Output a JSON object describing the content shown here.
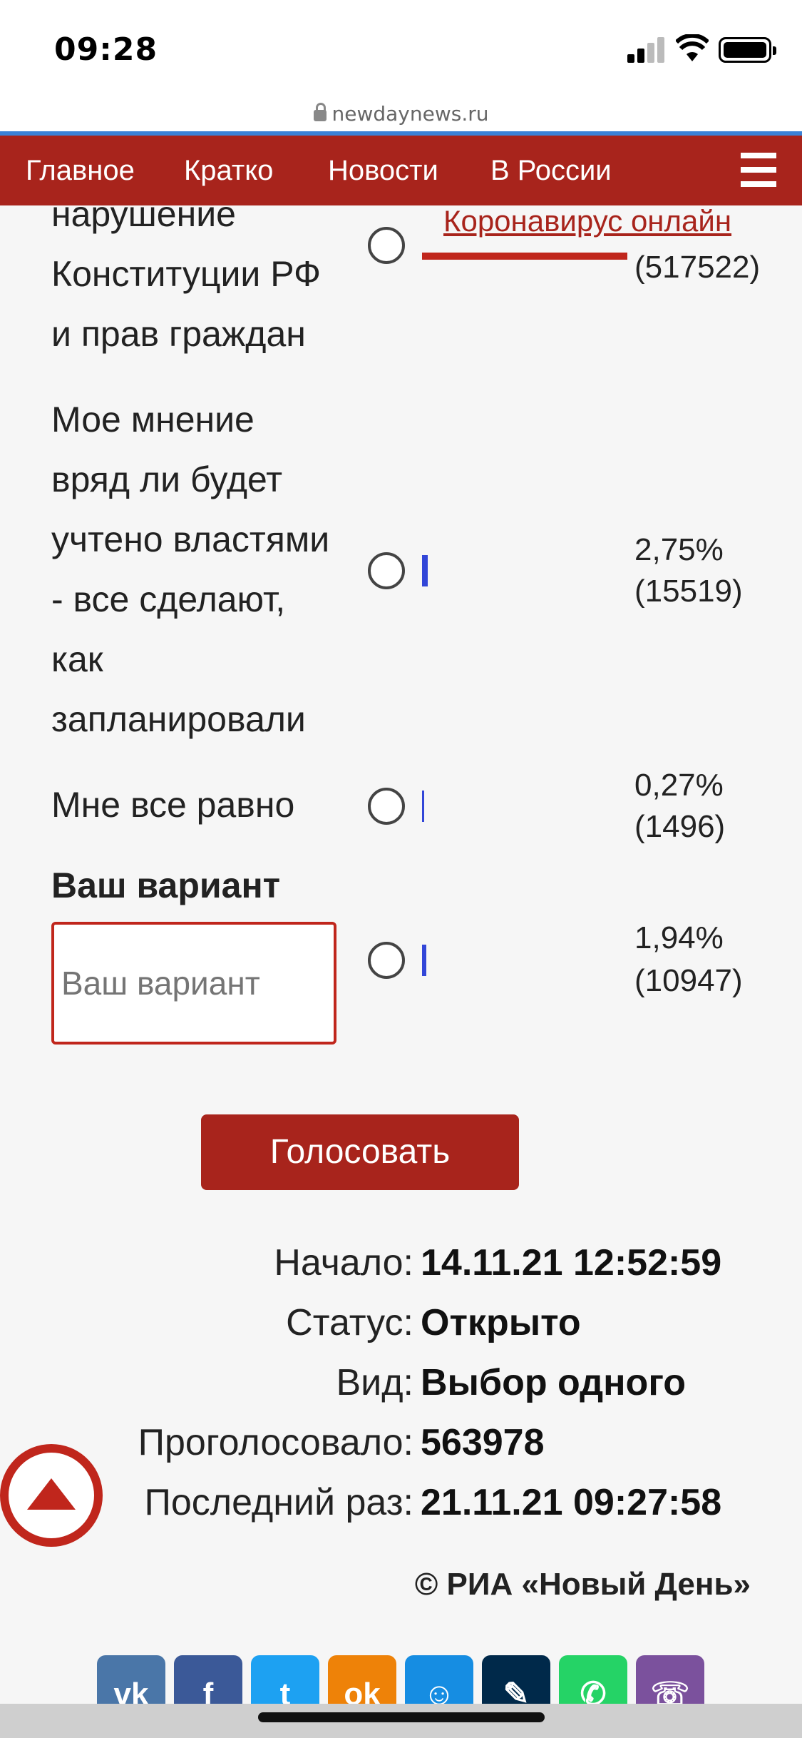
{
  "status": {
    "time": "09:28"
  },
  "browser": {
    "url": "newdaynews.ru"
  },
  "nav": {
    "items": [
      "Главное",
      "Кратко",
      "Новости",
      "В России"
    ]
  },
  "poll": {
    "options": [
      {
        "lines": [
          "нарушение",
          "Конституции РФ",
          "и прав граждан"
        ],
        "stats": "(517522)",
        "value": null
      },
      {
        "lines": [
          "Мое мнение",
          "вряд ли будет",
          "учтено властями",
          "- все сделают,",
          "как",
          "запланировали"
        ],
        "pct": "2,75%",
        "count": "(15519)",
        "value": 2.75
      },
      {
        "lines": [
          "Мне все равно"
        ],
        "pct": "0,27%",
        "count": "(1496)",
        "value": 0.27
      },
      {
        "lines": [],
        "pct": "1,94%",
        "count": "(10947)",
        "value": 1.94
      }
    ],
    "covid_link": "Коронавирус онлайн",
    "your_option_title": "Ваш вариант",
    "your_option_placeholder": "Ваш вариант",
    "vote_label": "Голосовать"
  },
  "info": [
    {
      "label": "Начало:",
      "value": "14.11.21 12:52:59"
    },
    {
      "label": "Статус:",
      "value": "Открыто"
    },
    {
      "label": "Вид:",
      "value": "Выбор одного"
    },
    {
      "label": "Проголосовало:",
      "value": "563978"
    },
    {
      "label": "Последний раз:",
      "value": "21.11.21 09:27:58"
    }
  ],
  "copyright": "© РИА «Новый День»",
  "share": [
    {
      "name": "vk",
      "label": "vk",
      "color": "#4a76a8",
      "icon": "vk-icon"
    },
    {
      "name": "facebook",
      "label": "f",
      "color": "#3b5998",
      "icon": "facebook-icon"
    },
    {
      "name": "twitter",
      "label": "t",
      "color": "#1da1f2",
      "icon": "twitter-icon"
    },
    {
      "name": "odnoklassniki",
      "label": "ok",
      "color": "#ee8208",
      "icon": "odnoklassniki-icon"
    },
    {
      "name": "moimir",
      "label": "☺",
      "color": "#168de2",
      "icon": "moimir-icon"
    },
    {
      "name": "livejournal",
      "label": "✎",
      "color": "#00294a",
      "icon": "livejournal-icon"
    },
    {
      "name": "whatsapp",
      "label": "✆",
      "color": "#25d366",
      "icon": "whatsapp-icon"
    },
    {
      "name": "viber",
      "label": "☏",
      "color": "#7b519d",
      "icon": "viber-icon"
    }
  ]
}
